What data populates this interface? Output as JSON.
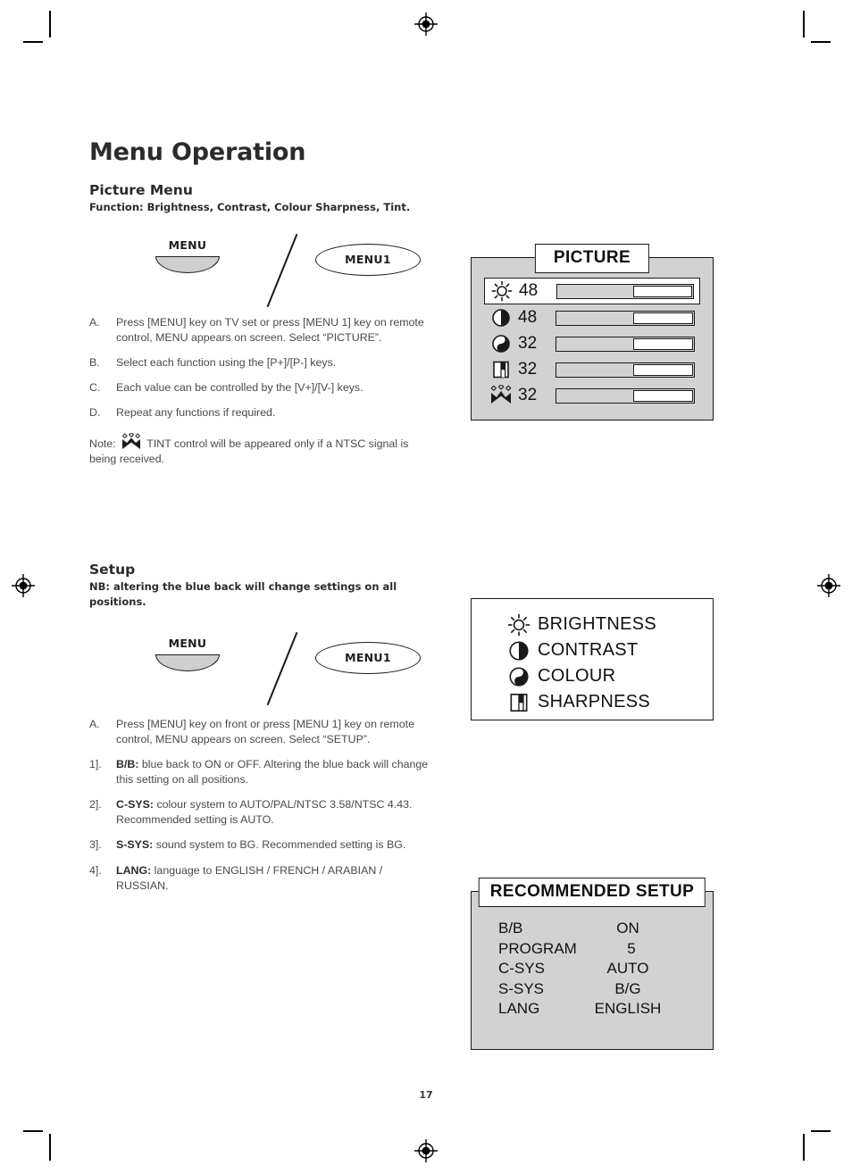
{
  "page": {
    "title": "Menu Operation",
    "number": "17"
  },
  "picture_section": {
    "heading": "Picture Menu",
    "subheading": "Function: Brightness, Contrast, Colour Sharpness, Tint.",
    "diagram": {
      "tv_key_label": "MENU",
      "remote_key_label": "MENU1",
      "tv_key_icon": "tv-menu-button-icon",
      "separator_icon": "slash-separator-icon"
    },
    "steps": [
      {
        "marker": "A.",
        "text": "Press [MENU] key on TV set or press [MENU 1] key on remote control, MENU appears on screen. Select “PICTURE”."
      },
      {
        "marker": "B.",
        "text": "Select each function using the [P+]/[P-] keys."
      },
      {
        "marker": "C.",
        "text": "Each value can be controlled by the [V+]/[V-] keys."
      },
      {
        "marker": "D.",
        "text": "Repeat any functions if required."
      }
    ],
    "note": {
      "prefix": "Note:",
      "icon": "tint-icon",
      "text": "TINT control will be appeared only if a NTSC signal is being received."
    }
  },
  "setup_section": {
    "heading": "Setup",
    "subheading": "NB: altering the blue back will change settings on all positions.",
    "diagram": {
      "tv_key_label": "MENU",
      "remote_key_label": "MENU1",
      "tv_key_icon": "tv-menu-button-icon",
      "separator_icon": "slash-separator-icon"
    },
    "steps": [
      {
        "marker": "A.",
        "bold": "",
        "text": "Press [MENU] key on front or press [MENU 1] key on remote control, MENU appears on screen. Select “SETUP”."
      },
      {
        "marker": "1].",
        "bold": "B/B:",
        "text": " blue back to ON or OFF. Altering the blue back will change this setting on all positions."
      },
      {
        "marker": "2].",
        "bold": "C-SYS:",
        "text": " colour system to AUTO/PAL/NTSC 3.58/NTSC 4.43. Recommended setting is AUTO."
      },
      {
        "marker": "3].",
        "bold": "S-SYS:",
        "text": " sound system to BG. Recommended setting is BG."
      },
      {
        "marker": "4].",
        "bold": "LANG:",
        "text": " language to ENGLISH / FRENCH / ARABIAN / RUSSIAN."
      }
    ]
  },
  "osd_picture": {
    "title": "PICTURE",
    "rows": [
      {
        "icon": "brightness-sun-icon",
        "value": "48",
        "fill_start_pct": 56,
        "selected": true
      },
      {
        "icon": "contrast-half-circle-icon",
        "value": "48",
        "fill_start_pct": 56,
        "selected": false
      },
      {
        "icon": "colour-yin-yang-icon",
        "value": "32",
        "fill_start_pct": 56,
        "selected": false
      },
      {
        "icon": "sharpness-split-square-icon",
        "value": "32",
        "fill_start_pct": 56,
        "selected": false
      },
      {
        "icon": "tint-icon",
        "value": "32",
        "fill_start_pct": 56,
        "selected": false
      }
    ]
  },
  "osd_legend": {
    "rows": [
      {
        "icon": "brightness-sun-icon",
        "label": "BRIGHTNESS"
      },
      {
        "icon": "contrast-half-circle-icon",
        "label": "CONTRAST"
      },
      {
        "icon": "colour-yin-yang-icon",
        "label": "COLOUR"
      },
      {
        "icon": "sharpness-split-square-icon",
        "label": "SHARPNESS"
      }
    ]
  },
  "osd_setup": {
    "title": "RECOMMENDED SETUP",
    "rows": [
      {
        "key": "B/B",
        "value": "ON"
      },
      {
        "key": "PROGRAM",
        "value": "5"
      },
      {
        "key": "C-SYS",
        "value": "AUTO"
      },
      {
        "key": "S-SYS",
        "value": "B/G"
      },
      {
        "key": "LANG",
        "value": "ENGLISH"
      }
    ]
  },
  "colors": {
    "panel_gray": "#d2d2d2",
    "ink": "#1a1a1a",
    "body_text": "#4a4a4a",
    "heading": "#2b2b2b"
  }
}
